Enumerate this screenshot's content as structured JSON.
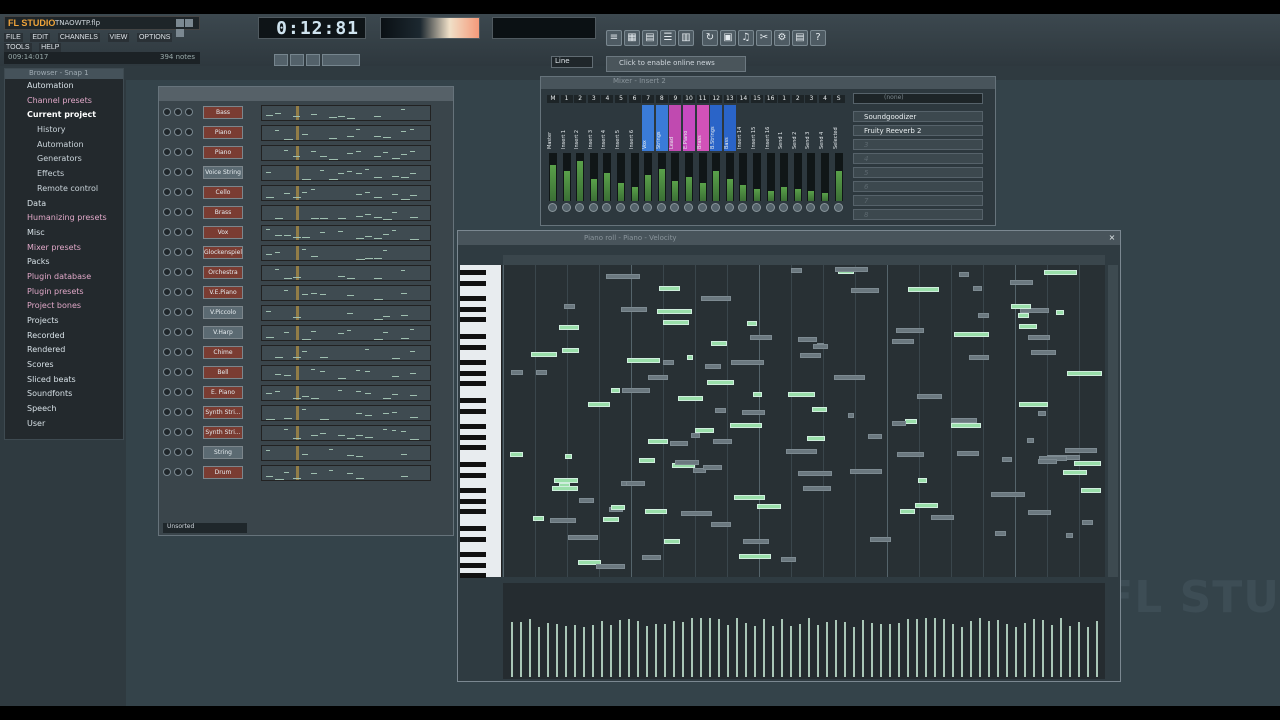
{
  "app": {
    "logo": "FL STUDIO",
    "filename": "TNAOWTP.flp",
    "menus": [
      "FILE",
      "EDIT",
      "CHANNELS",
      "VIEW",
      "OPTIONS",
      "TOOLS",
      "HELP"
    ],
    "hint_left": "009:14:017",
    "hint_right": "394 notes"
  },
  "transport": {
    "time": "0:12:81",
    "tempo_label": "Line",
    "online": "Click to enable online news"
  },
  "browser": {
    "title": "Browser - Snap 1",
    "items": [
      {
        "label": "Automation",
        "indent": 0
      },
      {
        "label": "Channel presets",
        "indent": 0
      },
      {
        "label": "Current project",
        "indent": 0,
        "selected": true
      },
      {
        "label": "History",
        "indent": 1
      },
      {
        "label": "Automation",
        "indent": 1
      },
      {
        "label": "Generators",
        "indent": 1
      },
      {
        "label": "Effects",
        "indent": 1
      },
      {
        "label": "Remote control",
        "indent": 1
      },
      {
        "label": "Data",
        "indent": 0
      },
      {
        "label": "Humanizing presets",
        "indent": 0
      },
      {
        "label": "Misc",
        "indent": 0
      },
      {
        "label": "Mixer presets",
        "indent": 0
      },
      {
        "label": "Packs",
        "indent": 0
      },
      {
        "label": "Plugin database",
        "indent": 0
      },
      {
        "label": "Plugin presets",
        "indent": 0
      },
      {
        "label": "Project bones",
        "indent": 0
      },
      {
        "label": "Projects",
        "indent": 0
      },
      {
        "label": "Recorded",
        "indent": 0
      },
      {
        "label": "Rendered",
        "indent": 0
      },
      {
        "label": "Scores",
        "indent": 0
      },
      {
        "label": "Sliced beats",
        "indent": 0
      },
      {
        "label": "Soundfonts",
        "indent": 0
      },
      {
        "label": "Speech",
        "indent": 0
      },
      {
        "label": "User",
        "indent": 0
      }
    ]
  },
  "step_sequencer": {
    "group": "Unsorted",
    "channels": [
      {
        "name": "Bass",
        "red": true
      },
      {
        "name": "Piano",
        "red": true
      },
      {
        "name": "Piano",
        "red": true
      },
      {
        "name": "Voice String",
        "red": false
      },
      {
        "name": "Cello",
        "red": true
      },
      {
        "name": "Brass",
        "red": true
      },
      {
        "name": "Vox",
        "red": true
      },
      {
        "name": "Glockenspiel",
        "red": true
      },
      {
        "name": "Orchestra",
        "red": true
      },
      {
        "name": "V.E.Piano",
        "red": true
      },
      {
        "name": "V.Piccolo",
        "red": false
      },
      {
        "name": "V.Harp",
        "red": false
      },
      {
        "name": "Chime",
        "red": true
      },
      {
        "name": "Bell",
        "red": true
      },
      {
        "name": "E. Piano",
        "red": true
      },
      {
        "name": "Synth Stri...",
        "red": true
      },
      {
        "name": "Synth Stri...",
        "red": true
      },
      {
        "name": "String",
        "red": false
      },
      {
        "name": "Drum",
        "red": true
      }
    ]
  },
  "mixer": {
    "title": "Mixer - Insert 2",
    "fx_header": "(none)",
    "strips": [
      {
        "num": "M",
        "label": "Master"
      },
      {
        "num": "1",
        "label": "Insert 1"
      },
      {
        "num": "2",
        "label": "Insert 2"
      },
      {
        "num": "3",
        "label": "Insert 3"
      },
      {
        "num": "4",
        "label": "Insert 4"
      },
      {
        "num": "5",
        "label": "Insert 5"
      },
      {
        "num": "6",
        "label": "Insert 6"
      },
      {
        "num": "7",
        "label": "Vox"
      },
      {
        "num": "8",
        "label": "Strings"
      },
      {
        "num": "9",
        "label": "Lead"
      },
      {
        "num": "10",
        "label": "E.Piano"
      },
      {
        "num": "11",
        "label": "Brass"
      },
      {
        "num": "12",
        "label": "B.Strings"
      },
      {
        "num": "13",
        "label": "Bass"
      },
      {
        "num": "14",
        "label": "Insert 14"
      },
      {
        "num": "15",
        "label": "Insert 15"
      },
      {
        "num": "16",
        "label": "Insert 16"
      },
      {
        "num": "1",
        "label": "Send 1"
      },
      {
        "num": "2",
        "label": "Send 2"
      },
      {
        "num": "3",
        "label": "Send 3"
      },
      {
        "num": "4",
        "label": "Send 4"
      },
      {
        "num": "S",
        "label": "Selected"
      }
    ],
    "fx_slots": [
      "Soundgoodizer",
      "Fruity Reeverb 2",
      "3",
      "4",
      "5",
      "6",
      "7",
      "8"
    ]
  },
  "piano_roll": {
    "title": "Piano roll - Piano - Velocity"
  },
  "watermark": "FL STU"
}
